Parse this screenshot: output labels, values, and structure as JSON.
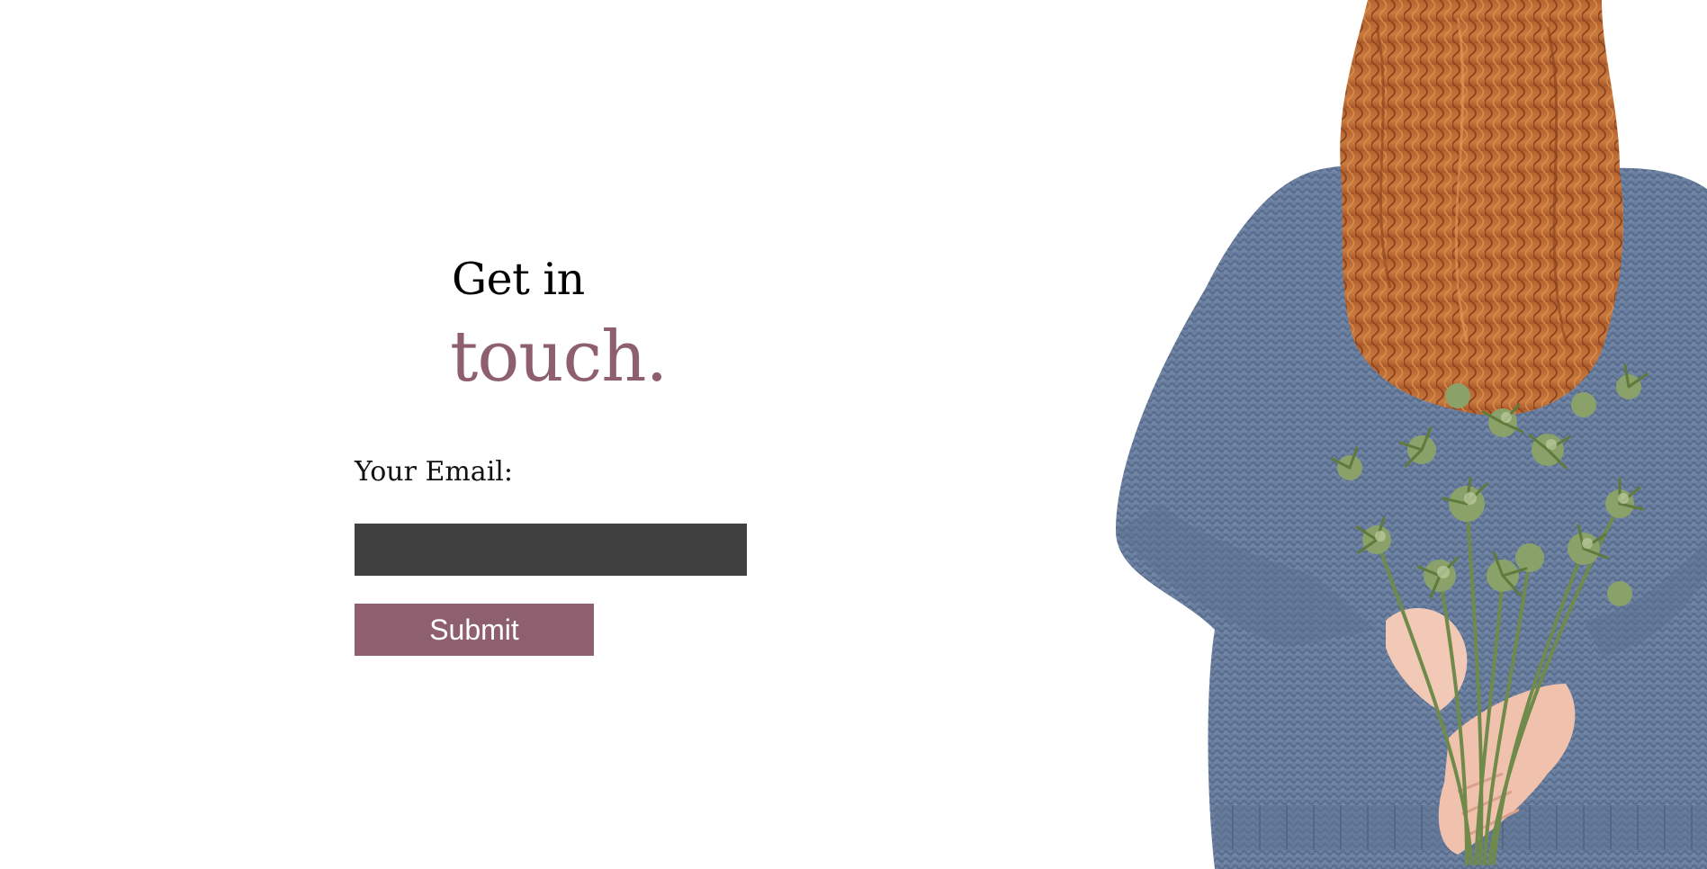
{
  "contact": {
    "heading_line1": "Get in",
    "heading_line2": "touch.",
    "email_label": "Your Email:",
    "email_value": "",
    "email_placeholder": "",
    "submit_label": "Submit"
  },
  "colors": {
    "accent": "#8e5f6f",
    "input_background": "#404040",
    "background": "#ffffff"
  },
  "image": {
    "icon": "woman-in-blue-sweater-holding-thistle-bouquet-photo"
  }
}
